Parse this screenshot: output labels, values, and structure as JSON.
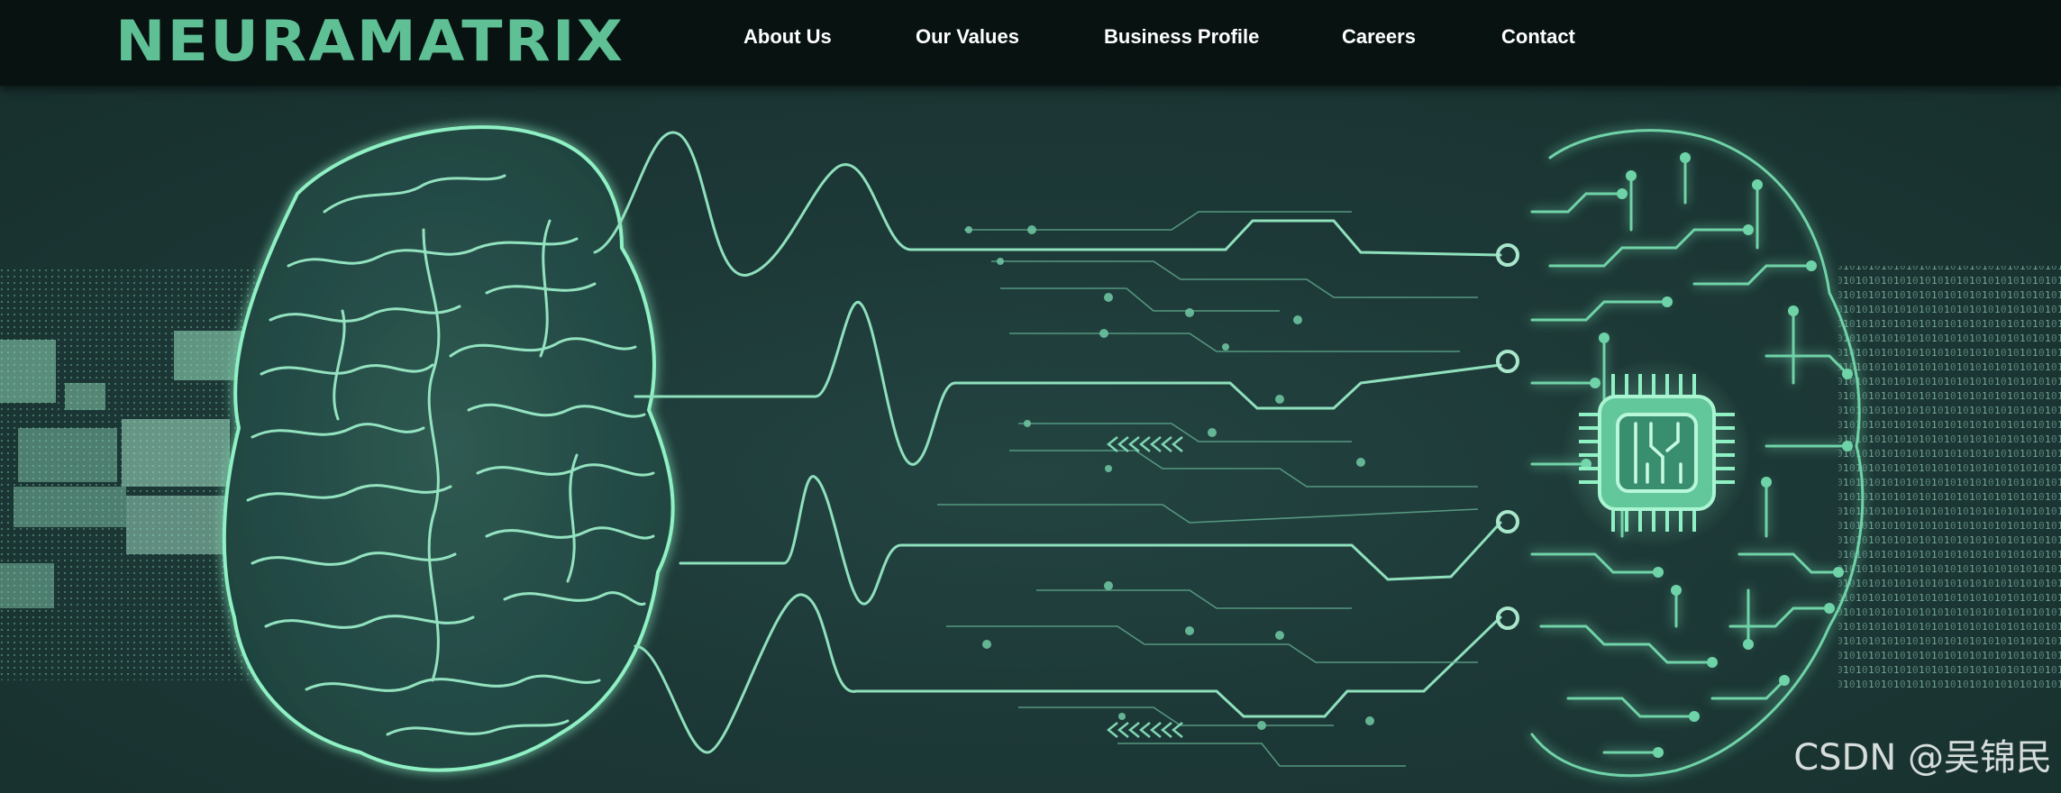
{
  "brand": {
    "logo_text": "NEURAMATRIX",
    "color": "#5fbf95"
  },
  "nav": {
    "items": [
      {
        "label": "About Us"
      },
      {
        "label": "Our Values"
      },
      {
        "label": "Business Profile"
      },
      {
        "label": "Careers"
      },
      {
        "label": "Contact"
      }
    ]
  },
  "hero": {
    "accent_color": "#7fe0b8",
    "illustration_icons": [
      "brain-icon",
      "circuit-chip-icon",
      "waveform-icon"
    ]
  },
  "watermark": {
    "text": "CSDN @吴锦民"
  }
}
